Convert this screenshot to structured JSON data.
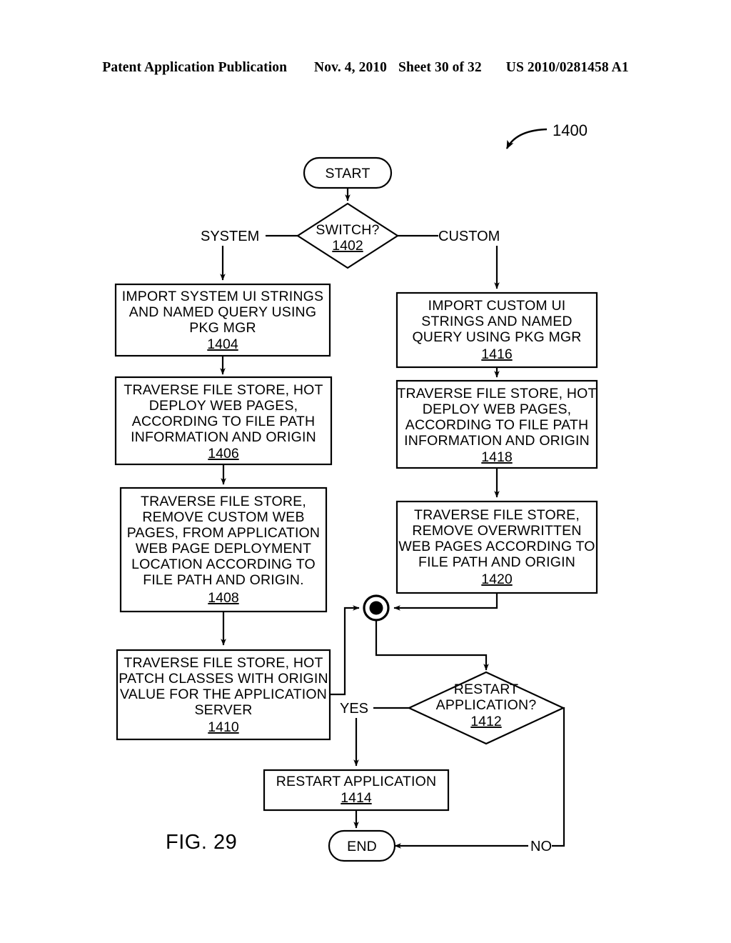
{
  "header": {
    "publication": "Patent Application Publication",
    "date": "Nov. 4, 2010",
    "sheet": "Sheet 30 of 32",
    "patent_number": "US 2010/0281458 A1"
  },
  "figure": {
    "caption": "FIG. 29",
    "reference_tag": "1400"
  },
  "nodes": {
    "start": {
      "label": "START"
    },
    "switch": {
      "label": "SWITCH?",
      "ref": "1402"
    },
    "import_system": {
      "line1": "IMPORT SYSTEM UI STRINGS",
      "line2": "AND NAMED QUERY USING",
      "line3": "PKG MGR",
      "ref": "1404"
    },
    "traverse_deploy_system": {
      "line1": "TRAVERSE FILE STORE, HOT",
      "line2": "DEPLOY WEB PAGES,",
      "line3": "ACCORDING TO FILE PATH",
      "line4": "INFORMATION AND ORIGIN",
      "ref": "1406"
    },
    "remove_custom_pages": {
      "line1": "TRAVERSE FILE STORE,",
      "line2": "REMOVE CUSTOM WEB",
      "line3": "PAGES, FROM APPLICATION",
      "line4": "WEB PAGE DEPLOYMENT",
      "line5": "LOCATION ACCORDING TO",
      "line6": "FILE PATH AND ORIGIN.",
      "ref": "1408"
    },
    "hot_patch_classes": {
      "line1": "TRAVERSE FILE STORE, HOT",
      "line2": "PATCH CLASSES WITH ORIGIN",
      "line3": "VALUE FOR THE APPLICATION",
      "line4": "SERVER",
      "ref": "1410"
    },
    "import_custom": {
      "line1": "IMPORT CUSTOM UI",
      "line2": "STRINGS AND NAMED",
      "line3": "QUERY USING PKG MGR",
      "ref": "1416"
    },
    "traverse_deploy_custom": {
      "line1": "TRAVERSE FILE STORE, HOT",
      "line2": "DEPLOY WEB PAGES,",
      "line3": "ACCORDING TO FILE PATH",
      "line4": "INFORMATION AND ORIGIN",
      "ref": "1418"
    },
    "remove_overwritten_pages": {
      "line1": "TRAVERSE FILE STORE,",
      "line2": "REMOVE OVERWRITTEN",
      "line3": "WEB PAGES ACCORDING TO",
      "line4": "FILE PATH AND ORIGIN",
      "ref": "1420"
    },
    "restart_decision": {
      "line1": "RESTART",
      "line2": "APPLICATION?",
      "ref": "1412"
    },
    "restart_application": {
      "line1": "RESTART APPLICATION",
      "ref": "1414"
    },
    "end": {
      "label": "END"
    },
    "junction": {
      "label": "merge-point"
    }
  },
  "edge_labels": {
    "system": "SYSTEM",
    "custom": "CUSTOM",
    "yes": "YES",
    "no": "NO"
  },
  "colors": {
    "ink": "#000000",
    "paper": "#ffffff"
  }
}
